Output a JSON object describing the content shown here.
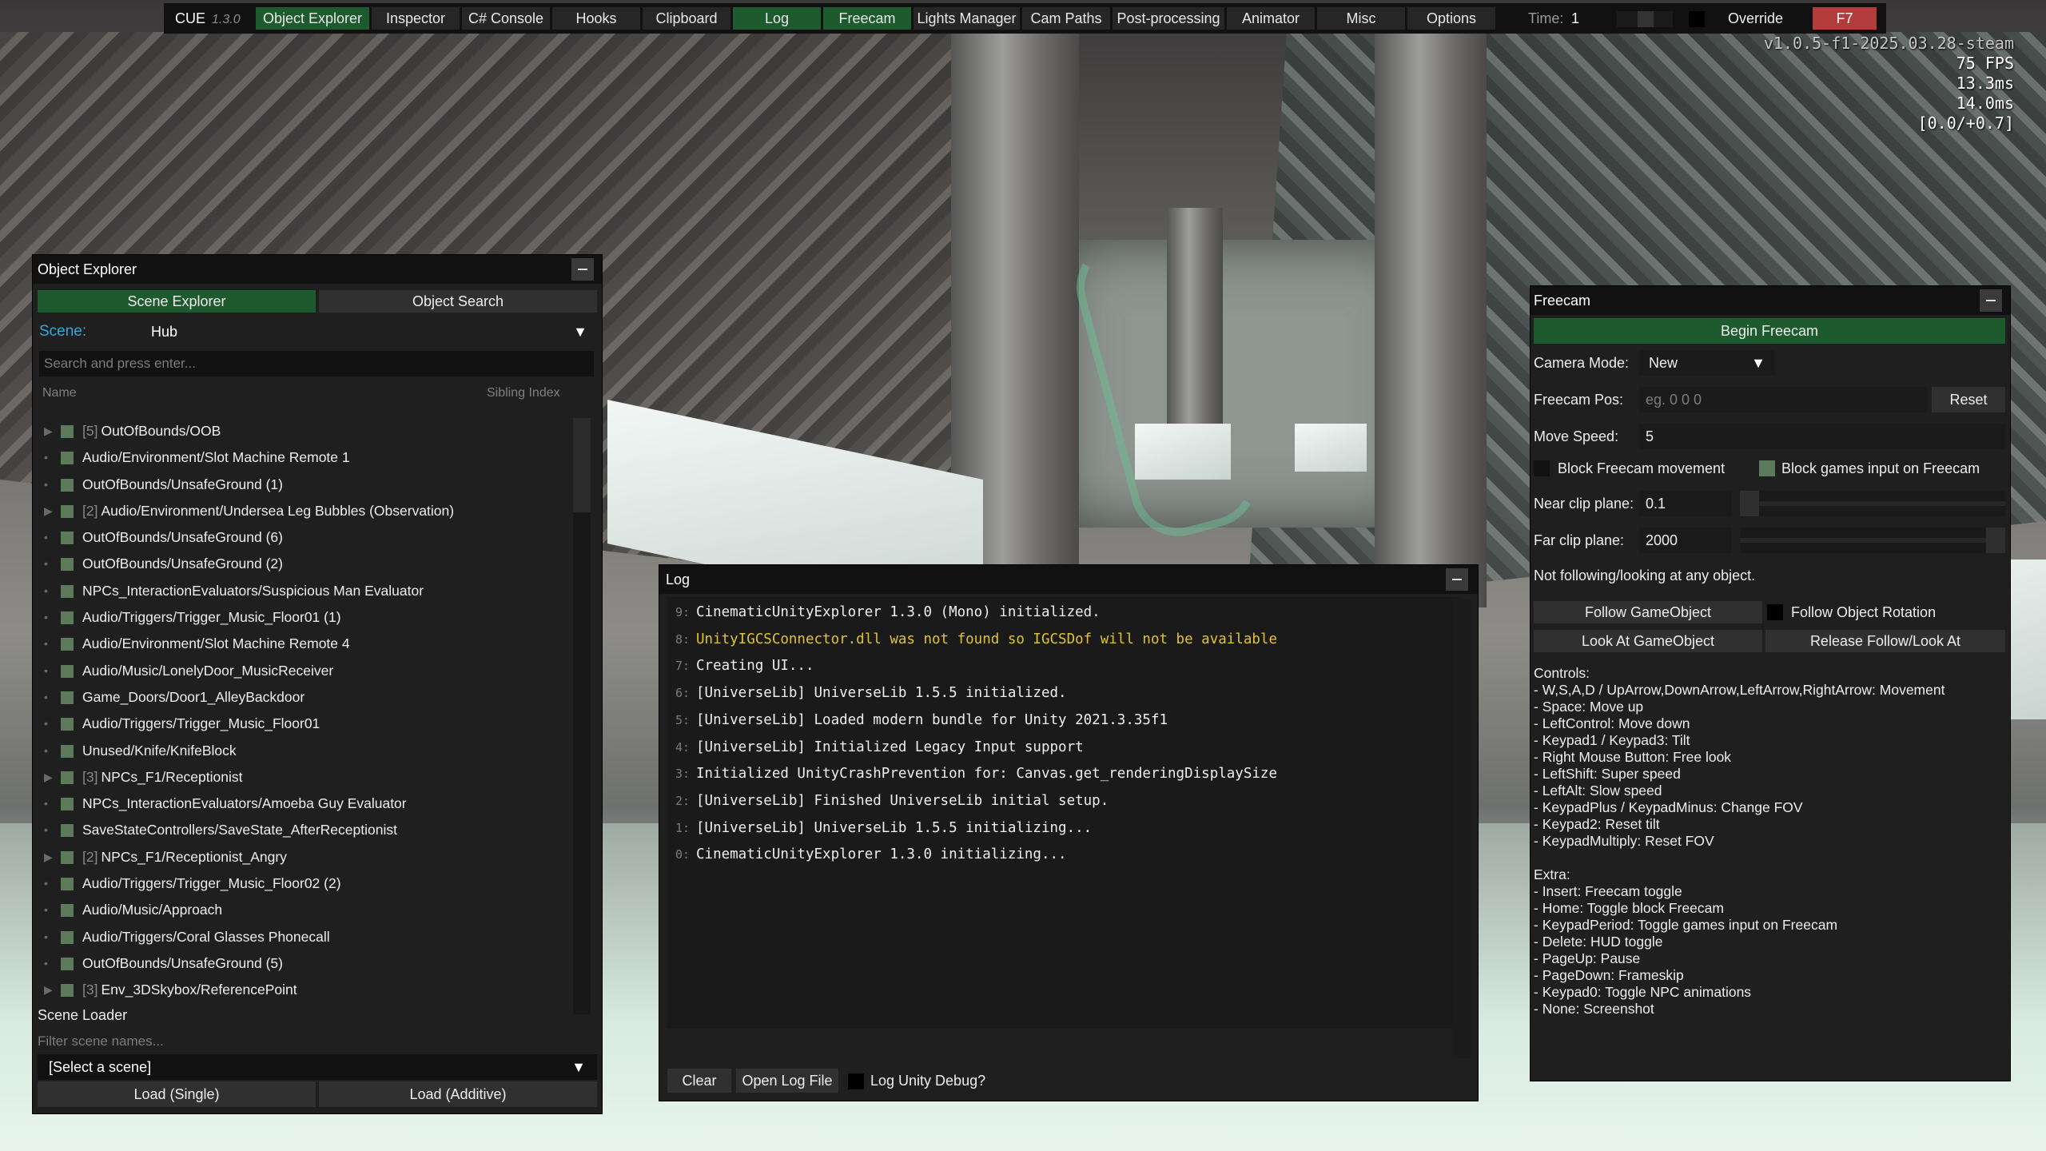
{
  "topbar": {
    "brand": "CUE",
    "version": "1.3.0",
    "tabs": [
      "Object Explorer",
      "Inspector",
      "C# Console",
      "Hooks",
      "Clipboard",
      "Log",
      "Freecam",
      "Lights Manager",
      "Cam Paths",
      "Post-processing",
      "Animator",
      "Misc",
      "Options"
    ],
    "active_tabs": [
      "Object Explorer",
      "Log",
      "Freecam"
    ],
    "time_label": "Time:",
    "time_value": "1",
    "override_label": "Override",
    "hotkey": "F7"
  },
  "stats": {
    "build": "v1.0.5-f1-2025.03.28-steam",
    "fps": "75 FPS",
    "frame_ms": "13.3ms",
    "frame_ms2": "14.0ms",
    "range": "[0.0/+0.7]"
  },
  "object_explorer": {
    "title": "Object Explorer",
    "tab_scene": "Scene Explorer",
    "tab_search": "Object Search",
    "scene_label": "Scene:",
    "scene_value": "Hub",
    "search_placeholder": "Search and press enter...",
    "col_name": "Name",
    "col_sibling": "Sibling Index",
    "items": [
      {
        "children": "[5]",
        "name": "OutOfBounds/OOB",
        "expandable": true
      },
      {
        "children": "",
        "name": "Audio/Environment/Slot Machine Remote 1",
        "expandable": false
      },
      {
        "children": "",
        "name": "OutOfBounds/UnsafeGround (1)",
        "expandable": false
      },
      {
        "children": "[2]",
        "name": "Audio/Environment/Undersea Leg Bubbles (Observation)",
        "expandable": true
      },
      {
        "children": "",
        "name": "OutOfBounds/UnsafeGround (6)",
        "expandable": false
      },
      {
        "children": "",
        "name": "OutOfBounds/UnsafeGround (2)",
        "expandable": false
      },
      {
        "children": "",
        "name": "NPCs_InteractionEvaluators/Suspicious Man Evaluator",
        "expandable": false
      },
      {
        "children": "",
        "name": "Audio/Triggers/Trigger_Music_Floor01 (1)",
        "expandable": false
      },
      {
        "children": "",
        "name": "Audio/Environment/Slot Machine Remote 4",
        "expandable": false
      },
      {
        "children": "",
        "name": "Audio/Music/LonelyDoor_MusicReceiver",
        "expandable": false
      },
      {
        "children": "",
        "name": "Game_Doors/Door1_AlleyBackdoor",
        "expandable": false
      },
      {
        "children": "",
        "name": "Audio/Triggers/Trigger_Music_Floor01",
        "expandable": false
      },
      {
        "children": "",
        "name": "Unused/Knife/KnifeBlock",
        "expandable": false
      },
      {
        "children": "[3]",
        "name": "NPCs_F1/Receptionist",
        "expandable": true
      },
      {
        "children": "",
        "name": "NPCs_InteractionEvaluators/Amoeba Guy Evaluator",
        "expandable": false
      },
      {
        "children": "",
        "name": "SaveStateControllers/SaveState_AfterReceptionist",
        "expandable": false
      },
      {
        "children": "[2]",
        "name": "NPCs_F1/Receptionist_Angry",
        "expandable": true
      },
      {
        "children": "",
        "name": "Audio/Triggers/Trigger_Music_Floor02 (2)",
        "expandable": false
      },
      {
        "children": "",
        "name": "Audio/Music/Approach",
        "expandable": false
      },
      {
        "children": "",
        "name": "Audio/Triggers/Coral Glasses Phonecall",
        "expandable": false
      },
      {
        "children": "",
        "name": "OutOfBounds/UnsafeGround (5)",
        "expandable": false
      },
      {
        "children": "[3]",
        "name": "Env_3DSkybox/ReferencePoint",
        "expandable": true
      }
    ],
    "scene_loader_title": "Scene Loader",
    "filter_placeholder": "Filter scene names...",
    "select_scene": "[Select a scene]",
    "load_single": "Load (Single)",
    "load_additive": "Load (Additive)"
  },
  "log": {
    "title": "Log",
    "lines": [
      {
        "n": "9:",
        "text": "CinematicUnityExplorer 1.3.0 (Mono) initialized.",
        "level": "info"
      },
      {
        "n": "8:",
        "text": "UnityIGCSConnector.dll was not found so IGCSDof will not be available",
        "level": "warn"
      },
      {
        "n": "7:",
        "text": "Creating UI...",
        "level": "info"
      },
      {
        "n": "6:",
        "text": "[UniverseLib] UniverseLib 1.5.5 initialized.",
        "level": "info"
      },
      {
        "n": "5:",
        "text": "[UniverseLib] Loaded modern bundle for Unity 2021.3.35f1",
        "level": "info"
      },
      {
        "n": "4:",
        "text": "[UniverseLib] Initialized Legacy Input support",
        "level": "info"
      },
      {
        "n": "3:",
        "text": "Initialized UnityCrashPrevention for: Canvas.get_renderingDisplaySize",
        "level": "info"
      },
      {
        "n": "2:",
        "text": "[UniverseLib] Finished UniverseLib initial setup.",
        "level": "info"
      },
      {
        "n": "1:",
        "text": "[UniverseLib] UniverseLib 1.5.5 initializing...",
        "level": "info"
      },
      {
        "n": "0:",
        "text": "CinematicUnityExplorer 1.3.0 initializing...",
        "level": "info"
      }
    ],
    "clear": "Clear",
    "open_log_file": "Open Log File",
    "log_unity_debug": "Log Unity Debug?"
  },
  "freecam": {
    "title": "Freecam",
    "begin": "Begin Freecam",
    "camera_mode_label": "Camera Mode:",
    "camera_mode_value": "New",
    "pos_label": "Freecam Pos:",
    "pos_placeholder": "eg. 0 0 0",
    "reset": "Reset",
    "move_speed_label": "Move Speed:",
    "move_speed_value": "5",
    "block_movement": "Block Freecam movement",
    "block_input": "Block games input on Freecam",
    "near_clip_label": "Near clip plane:",
    "near_clip_value": "0.1",
    "near_clip_level": 0.0,
    "far_clip_label": "Far clip plane:",
    "far_clip_value": "2000",
    "far_clip_level": 1.0,
    "following_status": "Not following/looking at any object.",
    "follow_gameobject": "Follow GameObject",
    "follow_rotation": "Follow Object Rotation",
    "look_at": "Look At GameObject",
    "release": "Release Follow/Look At",
    "controls_title": "Controls:",
    "controls": [
      "- W,S,A,D / UpArrow,DownArrow,LeftArrow,RightArrow: Movement",
      "- Space: Move up",
      "- LeftControl: Move down",
      "- Keypad1 / Keypad3: Tilt",
      "- Right Mouse Button: Free look",
      "- LeftShift: Super speed",
      "- LeftAlt: Slow speed",
      "- KeypadPlus / KeypadMinus: Change FOV",
      "- Keypad2: Reset tilt",
      "- KeypadMultiply: Reset FOV"
    ],
    "extra_title": "Extra:",
    "extra": [
      "- Insert: Freecam toggle",
      "- Home: Toggle block Freecam",
      "- KeypadPeriod: Toggle games input on Freecam",
      "- Delete: HUD toggle",
      "- PageUp: Pause",
      "- PageDown: Frameskip",
      "- Keypad0: Toggle NPC animations",
      "- None: Screenshot"
    ]
  }
}
